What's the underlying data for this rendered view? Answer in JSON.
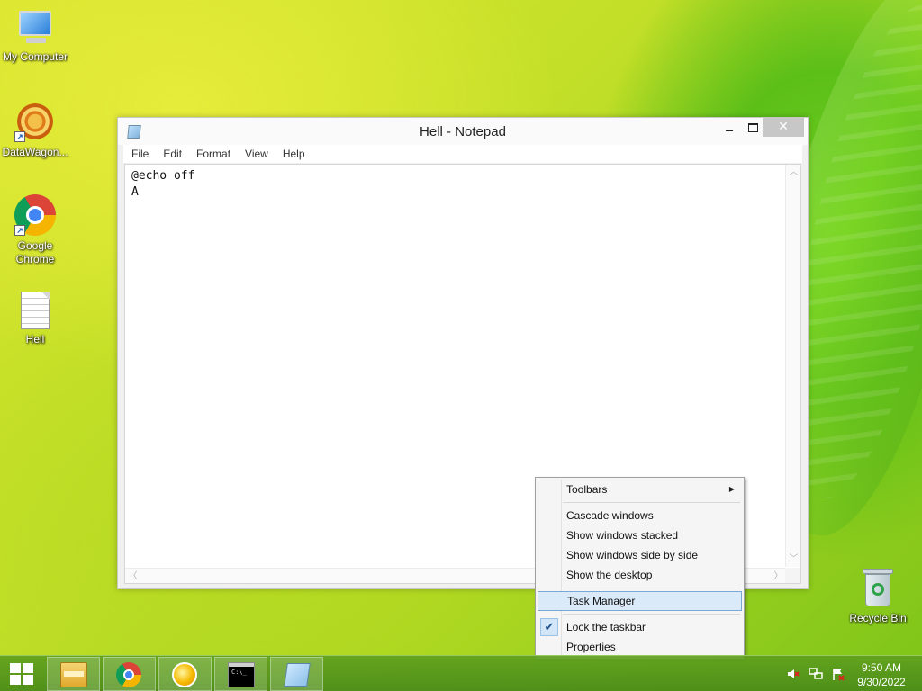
{
  "desktop": {
    "icons": [
      {
        "label": "My Computer",
        "icon": "computer-icon"
      },
      {
        "label": "DataWagon...",
        "icon": "datawagon-icon"
      },
      {
        "label": "Google Chrome",
        "icon": "chrome-icon"
      },
      {
        "label": "Hell",
        "icon": "text-file-icon"
      },
      {
        "label": "Recycle Bin",
        "icon": "recycle-bin-icon"
      }
    ]
  },
  "notepad": {
    "title": "Hell - Notepad",
    "close_glyph": "✕",
    "menu": [
      "File",
      "Edit",
      "Format",
      "View",
      "Help"
    ],
    "content": "@echo off\nA"
  },
  "context_menu": {
    "items": [
      {
        "label": "Toolbars",
        "submenu": true
      },
      {
        "label": "Cascade windows"
      },
      {
        "label": "Show windows stacked"
      },
      {
        "label": "Show windows side by side"
      },
      {
        "label": "Show the desktop"
      },
      {
        "label": "Task Manager",
        "highlighted": true
      },
      {
        "label": "Lock the taskbar",
        "checked": true
      },
      {
        "label": "Properties"
      }
    ],
    "check_glyph": "✔",
    "submenu_glyph": "▶"
  },
  "taskbar": {
    "apps": [
      "file-explorer-icon",
      "chrome-icon",
      "orange-app-icon",
      "command-prompt-icon",
      "notepad-icon"
    ],
    "cmd_text": "C:\\_",
    "tray": [
      "volume-muted-icon",
      "network-icon",
      "action-center-icon"
    ],
    "clock": {
      "time": "9:50 AM",
      "date": "9/30/2022"
    }
  },
  "colors": {
    "menu_highlight": "#dbeaf9",
    "menu_highlight_border": "#7aa8d6",
    "taskbar": "#5fa01e"
  }
}
